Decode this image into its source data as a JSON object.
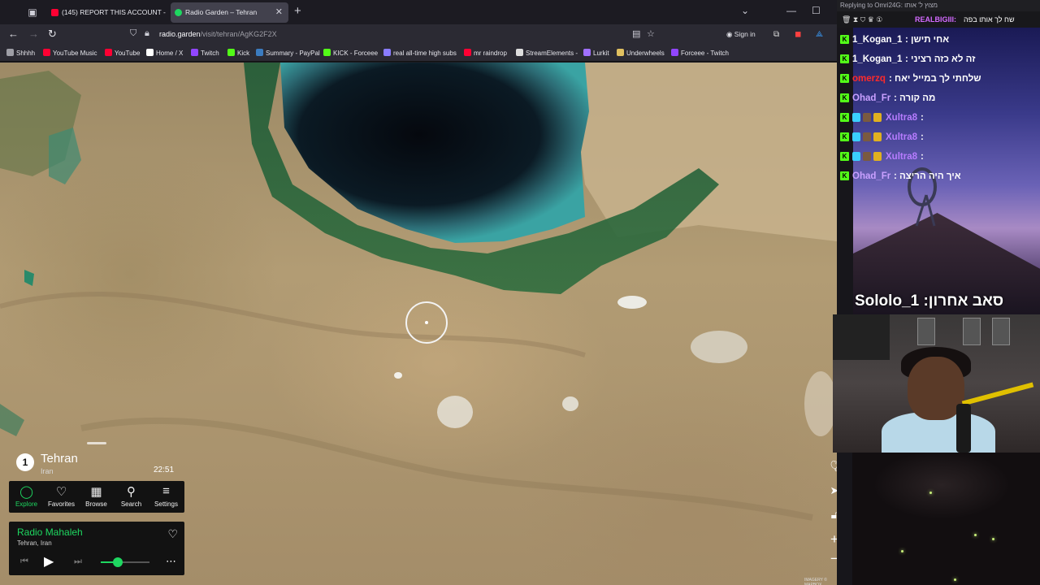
{
  "browser": {
    "tabs": [
      {
        "title": "(145) REPORT THIS ACCOUNT -",
        "favicon_color": "#ff0033"
      },
      {
        "title": "Radio Garden – Tehran",
        "favicon_color": "#1ed760"
      }
    ],
    "url_host": "radio.garden",
    "url_path": "/visit/tehran/AgKG2F2X",
    "signin_label": "Sign in",
    "bookmarks": [
      {
        "label": "Shhhh",
        "icon": "folder-icon",
        "color": "#9e9ea6"
      },
      {
        "label": "YouTube Music",
        "icon": "youtube-music-icon",
        "color": "#ff0033"
      },
      {
        "label": "YouTube",
        "icon": "youtube-icon",
        "color": "#ff0033"
      },
      {
        "label": "Home / X",
        "icon": "x-icon",
        "color": "#ffffff"
      },
      {
        "label": "Twitch",
        "icon": "twitch-icon",
        "color": "#9146ff"
      },
      {
        "label": "Kick",
        "icon": "kick-icon",
        "color": "#53fc18"
      },
      {
        "label": "Summary - PayPal",
        "icon": "paypal-icon",
        "color": "#3b7bbf"
      },
      {
        "label": "KICK - Forceee",
        "icon": "kick-icon",
        "color": "#53fc18"
      },
      {
        "label": "real all-time high subs",
        "icon": "chart-icon",
        "color": "#8a7cff"
      },
      {
        "label": "mr raindrop",
        "icon": "youtube-icon",
        "color": "#ff0033"
      },
      {
        "label": "StreamElements -",
        "icon": "streamelements-icon",
        "color": "#dddddd"
      },
      {
        "label": "Lurkit",
        "icon": "lurkit-icon",
        "color": "#a070ff"
      },
      {
        "label": "Underwheels",
        "icon": "underwheels-icon",
        "color": "#e0c060"
      },
      {
        "label": "Forceee - Twitch",
        "icon": "twitch-icon",
        "color": "#9146ff"
      }
    ]
  },
  "radio": {
    "city_count": "1",
    "city": "Tehran",
    "country": "Iran",
    "local_time": "22:51",
    "nav": [
      {
        "label": "Explore",
        "icon": "explore-icon",
        "glyph": "◯",
        "active": true
      },
      {
        "label": "Favorites",
        "icon": "heart-icon",
        "glyph": "♡",
        "active": false
      },
      {
        "label": "Browse",
        "icon": "map-icon",
        "glyph": "▦",
        "active": false
      },
      {
        "label": "Search",
        "icon": "search-icon",
        "glyph": "⚲",
        "active": false
      },
      {
        "label": "Settings",
        "icon": "menu-icon",
        "glyph": "≡",
        "active": false
      }
    ],
    "station": "Radio Mahaleh",
    "station_location": "Tehran, Iran",
    "volume_fraction": 0.35,
    "accent_color": "#1ed760",
    "attribution": "IMAGERY © MAPBOX"
  },
  "overlay": {
    "reply_text": "Replying to Omri24G: מצוץ ל' אותו",
    "pinned_user": "REALBIGIII:",
    "pinned_message": "שח לך אותו בפה",
    "chat": [
      {
        "user": "1_Kogan_1",
        "color": "#ffffff",
        "message": ": אחי תישן"
      },
      {
        "user": "1_Kogan_1",
        "color": "#ffffff",
        "message": ": זה לא כזה רציני"
      },
      {
        "user": "omerzq",
        "color": "#ff2a2a",
        "message": ": שלחתי לך במייל יאח"
      },
      {
        "user": "Ohad_Fr",
        "color": "#c9a0ff",
        "message": ": מה קורה"
      },
      {
        "user": "Xultra8",
        "color": "#b77cff",
        "message": ":"
      },
      {
        "user": "Xultra8",
        "color": "#b77cff",
        "message": ":"
      },
      {
        "user": "Xultra8",
        "color": "#b77cff",
        "message": ":"
      },
      {
        "user": "Ohad_Fr",
        "color": "#c9a0ff",
        "message": ": איך היה הריצה"
      }
    ],
    "last_sub_label": "Sololo_1 :סאב אחרון"
  }
}
